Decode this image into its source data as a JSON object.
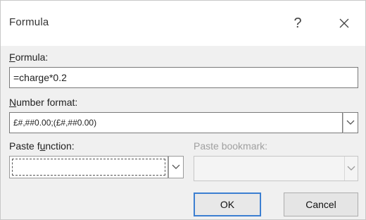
{
  "dialog": {
    "title": "Formula",
    "help_label": "?",
    "close_icon": "close-icon"
  },
  "formula": {
    "label_hotkey": "F",
    "label_rest": "ormula:",
    "value": "=charge*0.2"
  },
  "number_format": {
    "label_hotkey": "N",
    "label_rest": "umber format:",
    "value": "£#,##0.00;(£#,##0.00)"
  },
  "paste_function": {
    "label_before": "Paste f",
    "label_hotkey": "u",
    "label_after": "nction:",
    "value": ""
  },
  "paste_bookmark": {
    "label": "Paste bookmark:",
    "value": ""
  },
  "buttons": {
    "ok": "OK",
    "cancel": "Cancel"
  },
  "colors": {
    "default_button_border": "#3c7fd1",
    "disabled_text": "#a0a0a0"
  }
}
